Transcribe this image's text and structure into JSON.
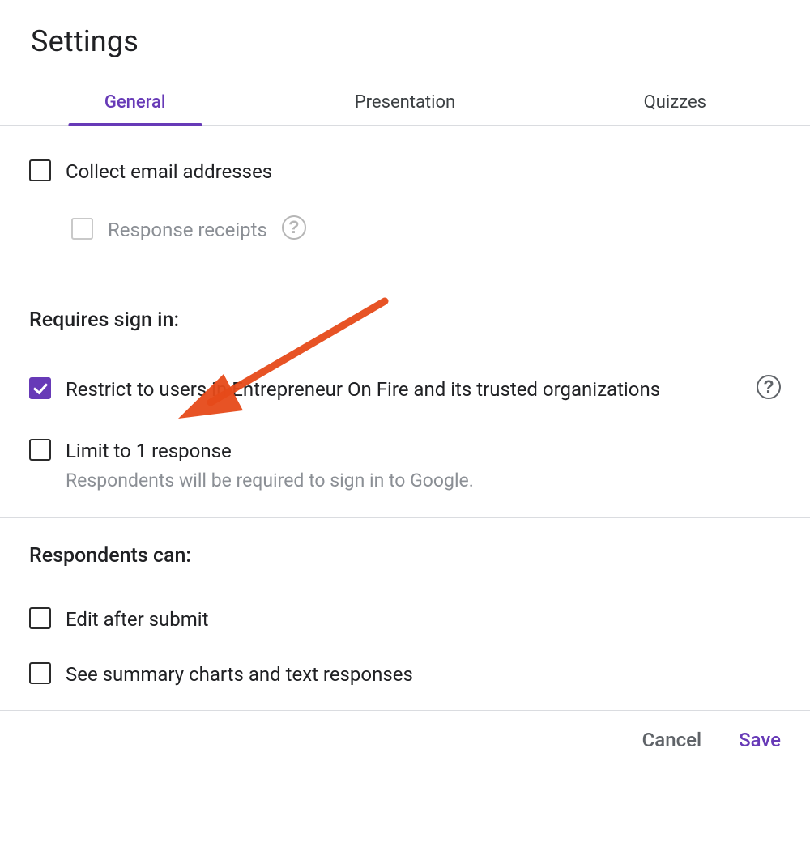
{
  "title": "Settings",
  "tabs": {
    "general": "General",
    "presentation": "Presentation",
    "quizzes": "Quizzes"
  },
  "options": {
    "collect_emails": "Collect email addresses",
    "response_receipts": "Response receipts",
    "requires_sign_in_heading": "Requires sign in:",
    "restrict_label": "Restrict to users in Entrepreneur On Fire and its trusted organizations",
    "limit_label": "Limit to 1 response",
    "limit_sub": "Respondents will be required to sign in to Google.",
    "respondents_heading": "Respondents can:",
    "edit_after_submit": "Edit after submit",
    "see_summary": "See summary charts and text responses"
  },
  "actions": {
    "cancel": "Cancel",
    "save": "Save"
  }
}
